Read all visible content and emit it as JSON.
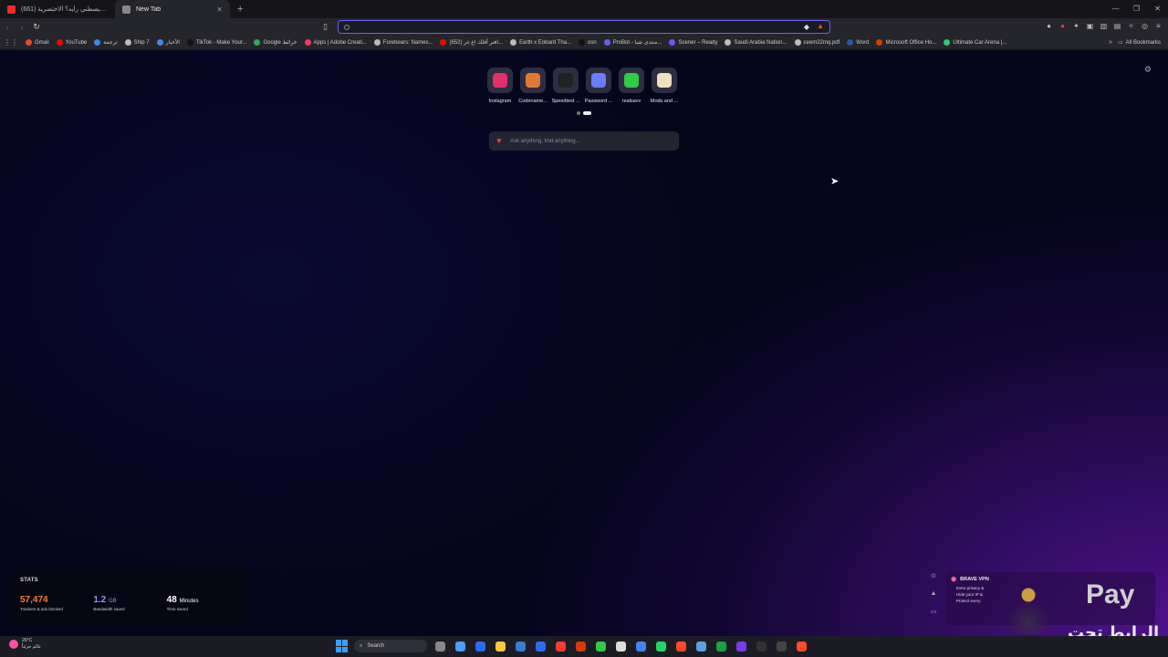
{
  "tabs": [
    {
      "title": "(661) كيف أسود يصطني رأيه؟ الاختصرية",
      "active": false,
      "color": "#ff2a2a"
    },
    {
      "title": "New Tab",
      "active": true,
      "color": "#888888"
    }
  ],
  "urlbar": {
    "value": "",
    "placeholder": ""
  },
  "bookmarks": [
    {
      "label": "Gmail",
      "color": "#ea4335"
    },
    {
      "label": "YouTube",
      "color": "#ff0000"
    },
    {
      "label": "ترجمة",
      "color": "#4285f4"
    },
    {
      "label": "Ship 7",
      "color": "#bbbbbb"
    },
    {
      "label": "الأخبار",
      "color": "#4285f4"
    },
    {
      "label": "TikTok - Make Your...",
      "color": "#111111"
    },
    {
      "label": "Google خرائط",
      "color": "#34a853"
    },
    {
      "label": "Apps | Adobe Creati...",
      "color": "#ff3366"
    },
    {
      "label": "Forebears: Names...",
      "color": "#bbbbbb"
    },
    {
      "label": "(652) افتر أفلك اغ غر...",
      "color": "#ff0000"
    },
    {
      "label": "Earth x Eobard Tha...",
      "color": "#bbbbbb"
    },
    {
      "label": "osn",
      "color": "#111111"
    },
    {
      "label": "ProBot - منتدى شبا...",
      "color": "#6a5cff"
    },
    {
      "label": "Scener – Ready",
      "color": "#7c4dff"
    },
    {
      "label": "Saudi Arabia Nation...",
      "color": "#bbbbbb"
    },
    {
      "label": "ceem22mq.pdf",
      "color": "#bbbbbb"
    },
    {
      "label": "Word",
      "color": "#2b579a"
    },
    {
      "label": "Microsoft Office Ho...",
      "color": "#d83b01"
    },
    {
      "label": "Ultimate Car Arena |...",
      "color": "#2ecc71"
    }
  ],
  "bookmarks_all": "All Bookmarks",
  "tiles": [
    {
      "label": "Instagram",
      "color": "#e1306c"
    },
    {
      "label": "Codename...",
      "color": "#e07a30"
    },
    {
      "label": "Speedtest ...",
      "color": "#222222"
    },
    {
      "label": "Password ...",
      "color": "#6a7dff"
    },
    {
      "label": "realsavv",
      "color": "#2ecc40"
    },
    {
      "label": "Mods and ...",
      "color": "#f0e0c0"
    }
  ],
  "search": {
    "placeholder": "Ask anything, find anything..."
  },
  "stats": {
    "heading": "STATS",
    "items": [
      {
        "value": "57,474",
        "unit": "",
        "label": "Trackers & ads blocked",
        "color": "#ff7a3d"
      },
      {
        "value": "1.2",
        "unit": "GB",
        "label": "Bandwidth saved",
        "color": "#9a8cff"
      },
      {
        "value": "48",
        "unit": "Minutes",
        "label": "Time saved",
        "color": "#ffffff"
      }
    ]
  },
  "vpn": {
    "title": "BRAVE VPN",
    "bullets": [
      "Extra privacy &",
      "Hide your IP &",
      "Protect every"
    ]
  },
  "overlay": {
    "apple_text": "Pay",
    "arabic_text": "الرابط تحت"
  },
  "taskbar": {
    "weather_temp": "26°C",
    "weather_desc": "غالم جزئياً",
    "search_label": "Search",
    "apps": [
      "#888888",
      "#4a9cff",
      "#2a6cff",
      "#ffc83d",
      "#3a7bd5",
      "#2a6cff",
      "#ff3b30",
      "#d83b01",
      "#2ecc40",
      "#dddddd",
      "#4285f4",
      "#25d366",
      "#ff4b2b",
      "#5aa0e0",
      "#16a34a",
      "#7c3aed",
      "#333333",
      "#444444",
      "#ff4b2b"
    ]
  }
}
